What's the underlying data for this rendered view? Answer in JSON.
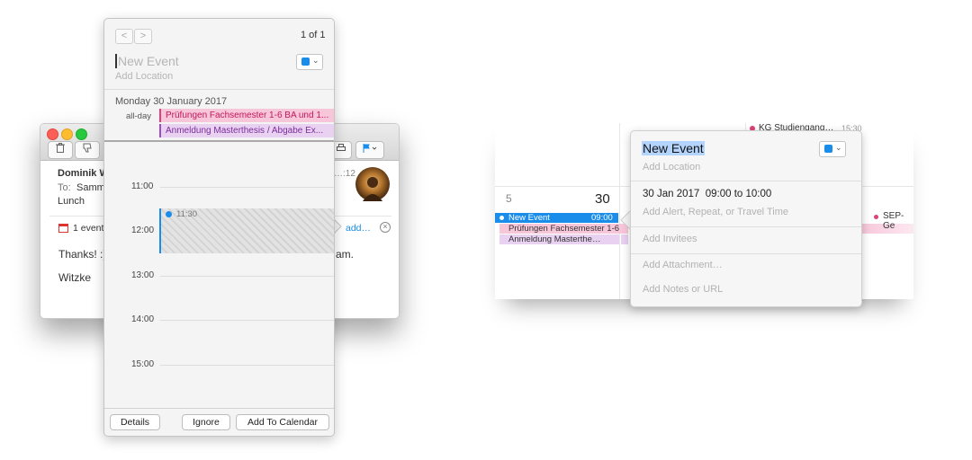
{
  "mail": {
    "sender": "Dominik W",
    "to_label": "To:",
    "to_value": "Sammy",
    "subject": "Lunch",
    "time": "…:12",
    "event_banner": "1 event",
    "add_link": "add…",
    "body_line1": "Thanks! :)",
    "body_line1_tail": "am.",
    "body_line2": "Witzke"
  },
  "popover": {
    "pager": "1 of 1",
    "title_placeholder": "New Event",
    "location_placeholder": "Add Location",
    "date": "Monday 30 January 2017",
    "allday_label": "all-day",
    "allday_events": [
      "Prüfungen Fachsemester 1-6 BA und 1...",
      "Anmeldung Masterthesis / Abgabe Ex..."
    ],
    "hours": [
      "11:00",
      "12:00",
      "13:00",
      "14:00",
      "15:00"
    ],
    "proposed_time": "11:30",
    "buttons": {
      "details": "Details",
      "ignore": "Ignore",
      "add": "Add To Calendar"
    }
  },
  "right_calendar": {
    "day_prev": "5",
    "day_current": "30",
    "top_event": "KG Studiengang…",
    "top_event_time": "15:30",
    "events": [
      {
        "label": "New Event",
        "time": "09:00"
      },
      {
        "label": "Prüfungen Fachsemester 1-6"
      },
      {
        "label": "Anmeldung Masterthe…"
      }
    ],
    "side_event": "SEP-Ge"
  },
  "event_editor": {
    "title": "New Event",
    "location_placeholder": "Add Location",
    "date": "30 Jan 2017",
    "start": "09:00",
    "to_word": "to",
    "end": "10:00",
    "alert_placeholder": "Add Alert, Repeat, or Travel Time",
    "invitees_placeholder": "Add Invitees",
    "attachment_placeholder": "Add Attachment…",
    "notes_placeholder": "Add Notes or URL"
  },
  "colors": {
    "blue": "#1a8cea",
    "pink_event": "#f7c6d9",
    "purple_event": "#e8d1f1",
    "pink_text": "#c2185b",
    "purple_text": "#7b2d9b"
  }
}
